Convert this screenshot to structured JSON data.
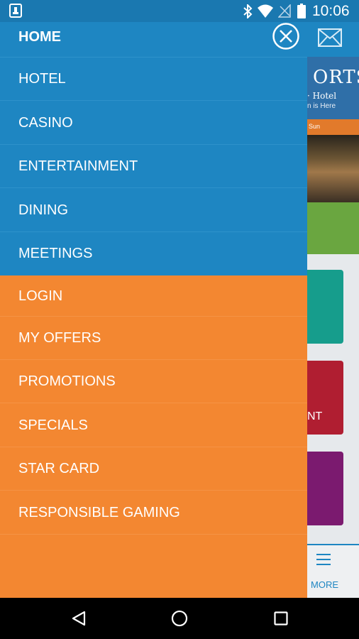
{
  "status_bar": {
    "time": "10:06",
    "icons": [
      "notification-icon",
      "bluetooth-icon",
      "wifi-icon",
      "no-signal-icon",
      "battery-icon"
    ]
  },
  "background_app": {
    "logo_text": "ORTS",
    "logo_sub": "· Hotel",
    "logo_tagline": "n is Here",
    "banner_text": "Sun",
    "tile_text": "NT",
    "more_label": "MORE",
    "header_icon": "mail-icon"
  },
  "drawer": {
    "close_icon": "close-circle-icon",
    "primary_items": [
      {
        "label": "HOME"
      },
      {
        "label": "HOTEL"
      },
      {
        "label": "CASINO"
      },
      {
        "label": "ENTERTAINMENT"
      },
      {
        "label": "DINING"
      },
      {
        "label": "MEETINGS"
      }
    ],
    "secondary_items": [
      {
        "label": "LOGIN"
      },
      {
        "label": "MY OFFERS"
      },
      {
        "label": "PROMOTIONS"
      },
      {
        "label": "SPECIALS"
      },
      {
        "label": "STAR CARD"
      },
      {
        "label": "RESPONSIBLE GAMING"
      }
    ]
  },
  "colors": {
    "primary_blue": "#1e86c2",
    "accent_orange": "#f38731",
    "status_bar": "#1a78b0"
  },
  "nav_bar": {
    "icons": [
      "back-icon",
      "home-icon",
      "recent-apps-icon"
    ]
  }
}
